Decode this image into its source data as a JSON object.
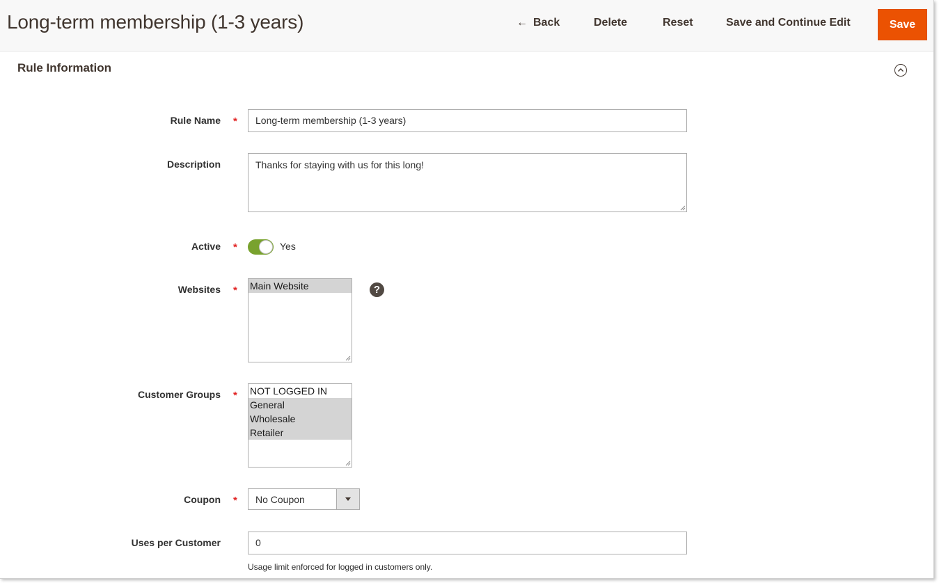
{
  "header": {
    "title": "Long-term membership (1-3 years)",
    "back_label": "Back",
    "back_icon": "arrow-left-icon",
    "delete_label": "Delete",
    "reset_label": "Reset",
    "save_continue_label": "Save and Continue Edit",
    "save_label": "Save",
    "accent_color": "#eb5202"
  },
  "section": {
    "title": "Rule Information",
    "collapse_icon": "chevron-up-circle-icon"
  },
  "form": {
    "rule_name": {
      "label": "Rule Name",
      "value": "Long-term membership (1-3 years)"
    },
    "description": {
      "label": "Description",
      "value": "Thanks for staying with us for this long!"
    },
    "active": {
      "label": "Active",
      "value": "Yes",
      "checked": true
    },
    "websites": {
      "label": "Websites",
      "options": [
        {
          "label": "Main Website",
          "selected": true
        }
      ]
    },
    "customer_groups": {
      "label": "Customer Groups",
      "options": [
        {
          "label": "NOT LOGGED IN",
          "selected": false
        },
        {
          "label": "General",
          "selected": true
        },
        {
          "label": "Wholesale",
          "selected": true
        },
        {
          "label": "Retailer",
          "selected": true
        }
      ]
    },
    "coupon": {
      "label": "Coupon",
      "value": "No Coupon"
    },
    "uses_per_customer": {
      "label": "Uses per Customer",
      "value": "0",
      "note": "Usage limit enforced for logged in customers only."
    },
    "required_mark": "*",
    "help_glyph": "?"
  }
}
